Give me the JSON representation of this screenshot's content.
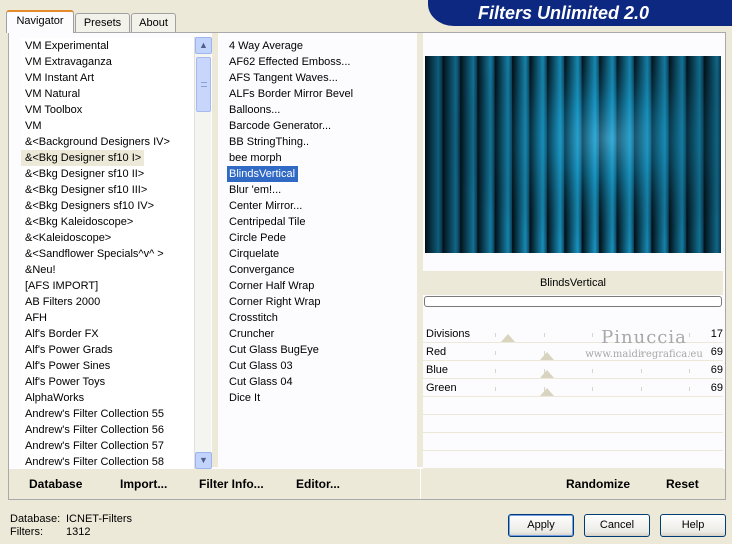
{
  "window": {
    "title": "Filters Unlimited 2.0"
  },
  "tabs": [
    {
      "label": "Navigator",
      "active": true
    },
    {
      "label": "Presets",
      "active": false
    },
    {
      "label": "About",
      "active": false
    }
  ],
  "categories": [
    "VM Experimental",
    "VM Extravaganza",
    "VM Instant Art",
    "VM Natural",
    "VM Toolbox",
    "VM",
    "&<Background Designers IV>",
    "&<Bkg Designer sf10 I>",
    "&<Bkg Designer sf10 II>",
    "&<Bkg Designer sf10 III>",
    "&<Bkg Designers sf10 IV>",
    "&<Bkg Kaleidoscope>",
    "&<Kaleidoscope>",
    "&<Sandflower Specials^v^ >",
    "&Neu!",
    "[AFS IMPORT]",
    "AB Filters 2000",
    "AFH",
    "Alf's Border FX",
    "Alf's Power Grads",
    "Alf's Power Sines",
    "Alf's Power Toys",
    "AlphaWorks",
    "Andrew's Filter Collection 55",
    "Andrew's Filter Collection 56",
    "Andrew's Filter Collection 57",
    "Andrew's Filter Collection 58"
  ],
  "selected_category_index": 7,
  "filters": [
    "4 Way Average",
    "AF62 Effected Emboss...",
    "AFS Tangent Waves...",
    "ALFs Border Mirror Bevel",
    "Balloons...",
    "Barcode Generator...",
    "BB StringThing..",
    "bee morph",
    "BlindsVertical",
    "Blur 'em!...",
    "Center Mirror...",
    "Centripedal Tile",
    "Circle Pede",
    "Cirquelate",
    "Convergance",
    "Corner Half Wrap",
    "Corner Right Wrap",
    "Crosstitch",
    "Cruncher",
    "Cut Glass  BugEye",
    "Cut Glass 03",
    "Cut Glass 04",
    "Dice It"
  ],
  "selected_filter_index": 8,
  "preview": {
    "filter_name": "BlindsVertical",
    "progress": 0
  },
  "sliders": [
    {
      "label": "Divisions",
      "value": 17,
      "max": 255
    },
    {
      "label": "Red",
      "value": 69,
      "max": 255
    },
    {
      "label": "Blue",
      "value": 69,
      "max": 255
    },
    {
      "label": "Green",
      "value": 69,
      "max": 255
    }
  ],
  "watermark": {
    "title": "Pinuccia",
    "url": "www.maidiregrafica.eu"
  },
  "toolbar": {
    "database": "Database",
    "import": "Import...",
    "filter_info": "Filter Info...",
    "editor": "Editor...",
    "randomize": "Randomize",
    "reset": "Reset"
  },
  "footer": {
    "database_label": "Database:",
    "database_value": "ICNET-Filters",
    "filters_label": "Filters:",
    "filters_value": "1312",
    "apply": "Apply",
    "cancel": "Cancel",
    "help": "Help"
  },
  "colors": {
    "banner": "#0c2880",
    "selection": "#316ac5",
    "preview_cyan": "#1a9ac8",
    "dialog_bg": "#ece9d8"
  },
  "icons": [
    "scroll-up-arrow-icon",
    "scroll-down-arrow-icon"
  ]
}
